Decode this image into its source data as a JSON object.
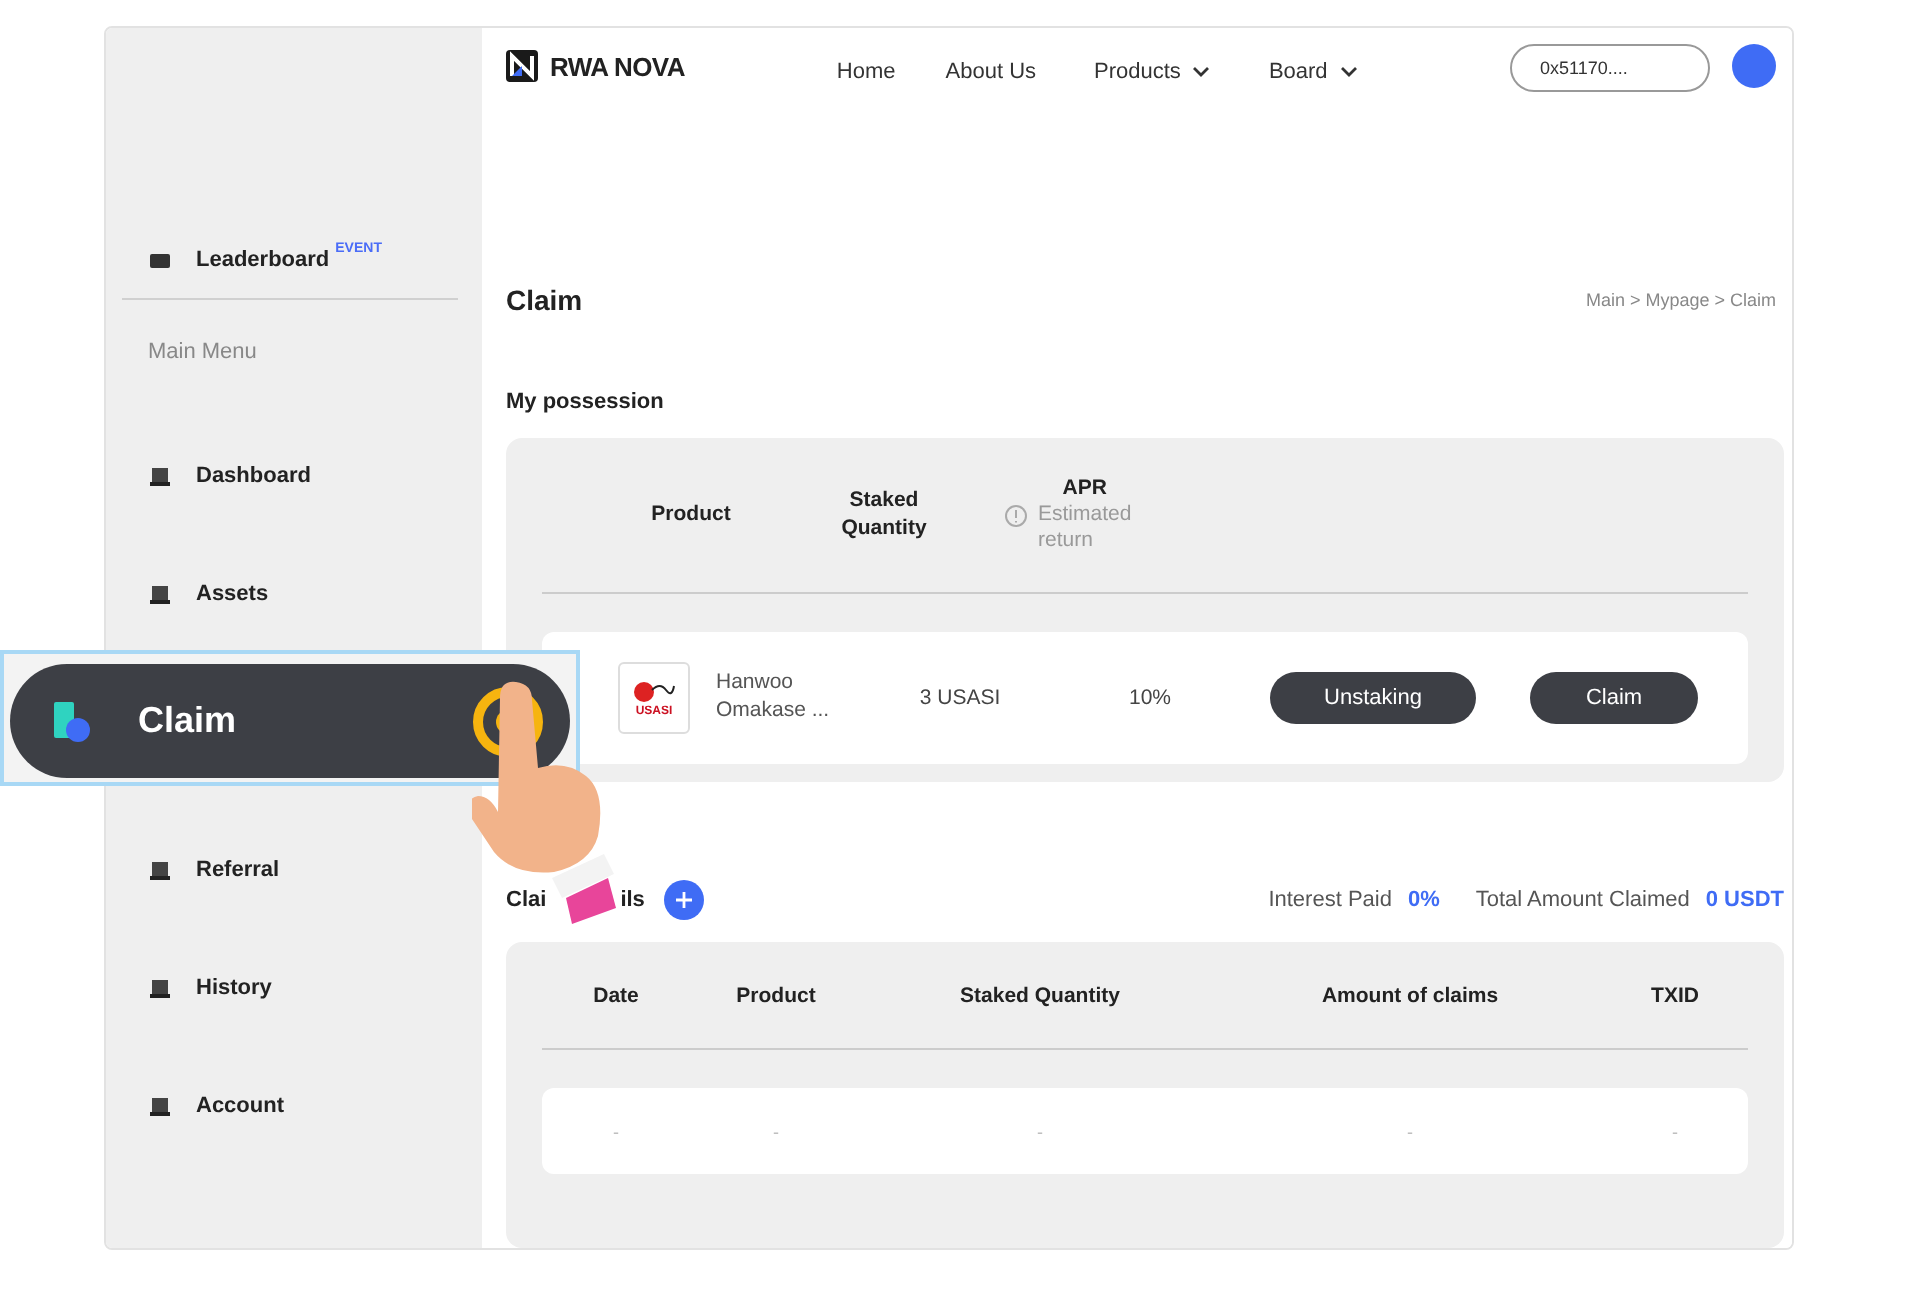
{
  "sidebar": {
    "items": [
      {
        "label": "Leaderboard",
        "badge": "EVENT",
        "kind": "top"
      },
      {
        "label": "Main Menu",
        "kind": "heading"
      },
      {
        "label": "Dashboard",
        "kind": "link"
      },
      {
        "label": "Assets",
        "kind": "link"
      },
      {
        "label": "Referral",
        "kind": "link"
      },
      {
        "label": "History",
        "kind": "link"
      },
      {
        "label": "Account",
        "kind": "link"
      }
    ]
  },
  "header": {
    "logo": "RWA NOVA",
    "nav": [
      {
        "label": "Home",
        "dropdown": false
      },
      {
        "label": "About Us",
        "dropdown": false
      },
      {
        "label": "Products",
        "dropdown": true
      },
      {
        "label": "Board",
        "dropdown": true
      }
    ],
    "wallet": "0x51170...."
  },
  "page": {
    "title": "Claim",
    "breadcrumb": "Main > Mypage > Claim"
  },
  "possession": {
    "title": "My possession",
    "columns": [
      "Product",
      "Staked\nQuantity",
      "APR"
    ],
    "apr_note": "Estimated\nreturn",
    "rows": [
      {
        "logo_text": "USASI",
        "product": "Hanwoo\nOmakase ...",
        "quantity": "3 USASI",
        "apr": "10%",
        "buttons": [
          "Unstaking",
          "Claim"
        ]
      }
    ]
  },
  "claims": {
    "title_start": "Clai",
    "title_end": "ils",
    "stats": [
      {
        "label": "Interest Paid",
        "value": "0%"
      },
      {
        "label": "Total Amount Claimed",
        "value": "0 USDT"
      }
    ],
    "columns": [
      "Date",
      "Product",
      "Staked Quantity",
      "Amount of claims",
      "TXID"
    ],
    "rows": [
      [
        "-",
        "-",
        "-",
        "-",
        "-"
      ]
    ]
  },
  "callout": {
    "label": "Claim"
  }
}
